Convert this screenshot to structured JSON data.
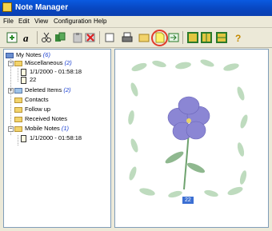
{
  "window": {
    "title": "Note Manager"
  },
  "menu": [
    "File",
    "Edit",
    "View",
    "Configuration",
    "Help"
  ],
  "toolbar": {
    "buttons": [
      "new-icon",
      "text-icon",
      "cut-icon",
      "copy-icon",
      "paste-icon",
      "delete-icon",
      "blank-icon",
      "print-icon",
      "new-note-icon",
      "send-icon",
      "layout1-icon",
      "layout2-icon",
      "layout3-icon",
      "help-icon"
    ],
    "highlight_color": "#e23a2a"
  },
  "tree": {
    "root": {
      "label": "My Notes",
      "count": "(6)"
    },
    "items": [
      {
        "label": "Miscellaneous",
        "count": "(2)"
      },
      {
        "label": "1/1/2000 - 01:58:18",
        "count": ""
      },
      {
        "label": "22",
        "count": ""
      },
      {
        "label": "Deleted Items",
        "count": "(2)"
      },
      {
        "label": "Contacts",
        "count": ""
      },
      {
        "label": "Follow up",
        "count": ""
      },
      {
        "label": "Received Notes",
        "count": ""
      },
      {
        "label": "Mobile Notes",
        "count": "(1)"
      },
      {
        "label": "1/1/2000 - 01:58:18",
        "count": ""
      }
    ]
  },
  "preview": {
    "page_label": "22",
    "flower_color": "#8b86d4",
    "leaf_color": "#8fb88f"
  }
}
